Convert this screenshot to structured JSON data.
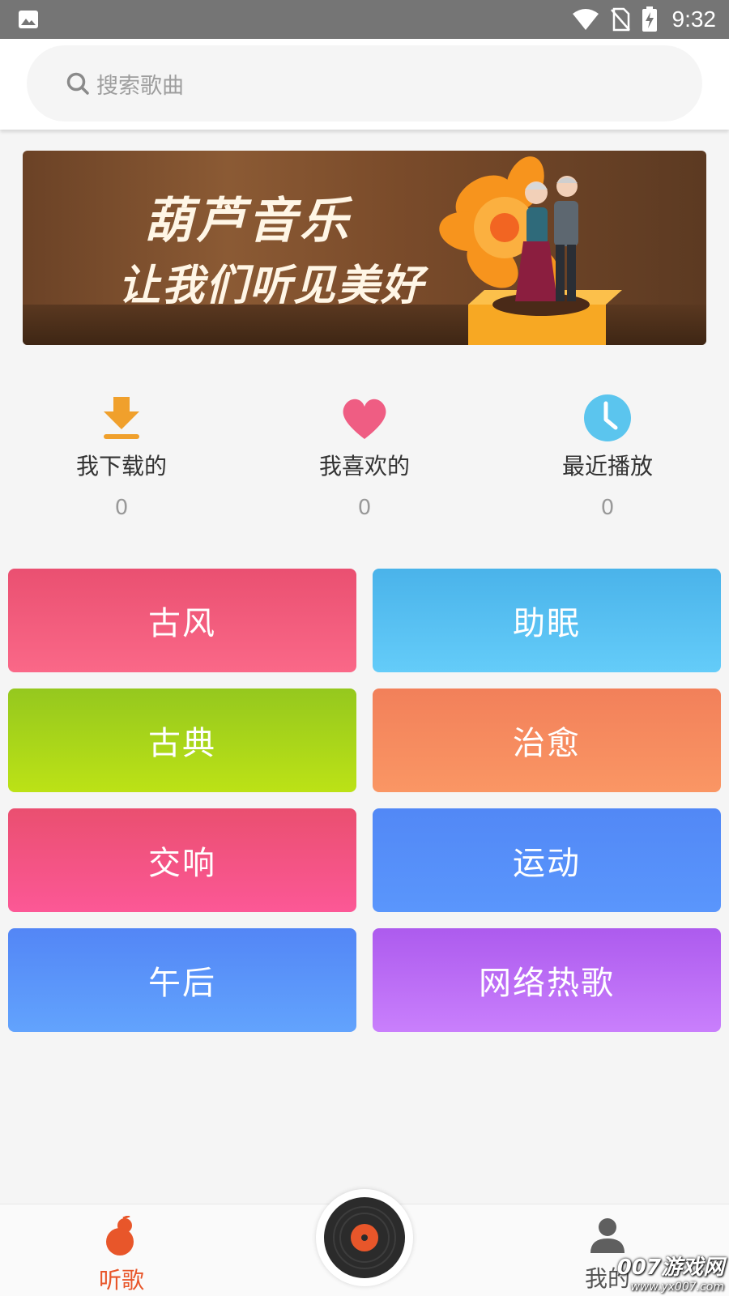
{
  "status_bar": {
    "time": "9:32",
    "icons": [
      "image-icon",
      "wifi-icon",
      "no-sim-icon",
      "battery-charging-icon"
    ]
  },
  "search": {
    "placeholder": "搜索歌曲",
    "icon": "search-icon"
  },
  "banner": {
    "title": "葫芦音乐",
    "slogan": "让我们听见美好"
  },
  "quick_actions": [
    {
      "icon": "download-icon",
      "label": "我下载的",
      "count": "0",
      "color": "#f0a02c"
    },
    {
      "icon": "heart-icon",
      "label": "我喜欢的",
      "count": "0",
      "color": "#ef5d83"
    },
    {
      "icon": "clock-icon",
      "label": "最近播放",
      "count": "0",
      "color": "#5bc5ee"
    }
  ],
  "categories": [
    {
      "label": "古风",
      "colors": [
        "#ea5071",
        "#fa6888"
      ]
    },
    {
      "label": "助眠",
      "colors": [
        "#4ab3ea",
        "#64ccf9"
      ]
    },
    {
      "label": "古典",
      "colors": [
        "#95c81e",
        "#bce216"
      ]
    },
    {
      "label": "治愈",
      "colors": [
        "#f2805a",
        "#fa9664"
      ]
    },
    {
      "label": "交响",
      "colors": [
        "#ea4f70",
        "#fc5896"
      ]
    },
    {
      "label": "运动",
      "colors": [
        "#5288f6",
        "#5a96fc"
      ]
    },
    {
      "label": "午后",
      "colors": [
        "#5386f6",
        "#62a3fd"
      ]
    },
    {
      "label": "网络热歌",
      "colors": [
        "#ad5bee",
        "#c97ffc"
      ]
    }
  ],
  "bottom_nav": {
    "listen_label": "听歌",
    "mine_label": "我的",
    "active_color": "#e8562a",
    "inactive_color": "#555555"
  },
  "watermark": {
    "text": "007游戏网",
    "url": "www.yx007.com"
  }
}
